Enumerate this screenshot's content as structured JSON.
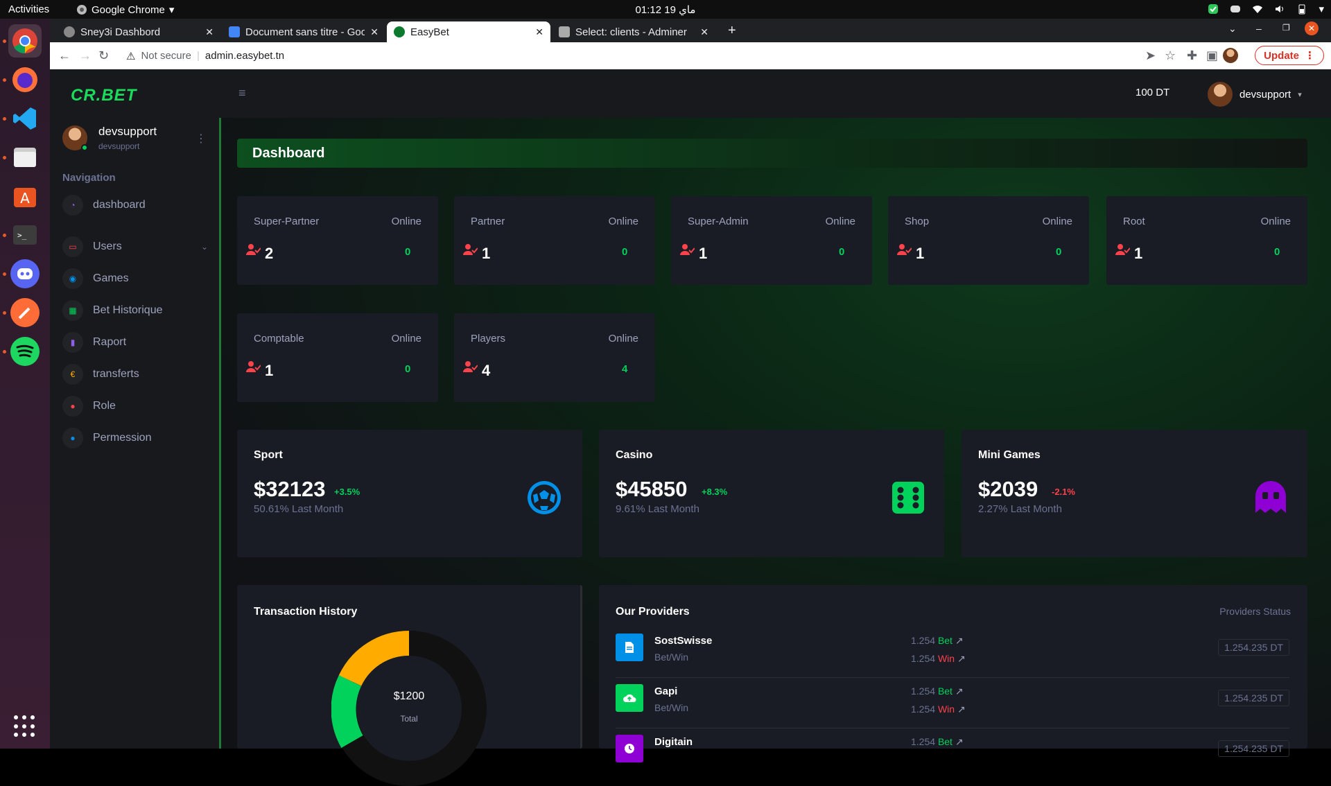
{
  "os_topbar": {
    "activities": "Activities",
    "app_name": "Google Chrome",
    "clock": "01:12  ماي 19"
  },
  "browser": {
    "tabs": [
      {
        "title": "Sney3i Dashbord",
        "active": false
      },
      {
        "title": "Document sans titre - Goo",
        "active": false
      },
      {
        "title": "EasyBet",
        "active": true
      },
      {
        "title": "Select: clients - Adminer",
        "active": false
      }
    ],
    "not_secure": "Not secure",
    "url": "admin.easybet.tn",
    "update_label": "Update"
  },
  "app": {
    "logo": "CR.BET",
    "balance": "100 DT",
    "username": "devsupport",
    "sidebar": {
      "user": {
        "name": "devsupport",
        "sub": "devsupport"
      },
      "nav_title": "Navigation",
      "items": [
        {
          "label": "dashboard",
          "icon": "speedometer-icon",
          "color": "#8f5fe8"
        },
        {
          "label": "Users",
          "icon": "monitor-icon",
          "color": "#fc424a"
        },
        {
          "label": "Games",
          "icon": "gamepad-icon",
          "color": "#0090e7"
        },
        {
          "label": "Bet Historique",
          "icon": "table-icon",
          "color": "#00d25b"
        },
        {
          "label": "Raport",
          "icon": "chart-icon",
          "color": "#8f5fe8"
        },
        {
          "label": "transferts",
          "icon": "euro-icon",
          "color": "#ffab00"
        },
        {
          "label": "Role",
          "icon": "pin-icon",
          "color": "#fc424a"
        },
        {
          "label": "Permession",
          "icon": "key-icon",
          "color": "#0090e7"
        }
      ]
    },
    "page_title": "Dashboard",
    "stats": [
      {
        "title": "Super-Partner",
        "online_label": "Online",
        "count": "2",
        "online": "0"
      },
      {
        "title": "Partner",
        "online_label": "Online",
        "count": "1",
        "online": "0"
      },
      {
        "title": "Super-Admin",
        "online_label": "Online",
        "count": "1",
        "online": "0"
      },
      {
        "title": "Shop",
        "online_label": "Online",
        "count": "1",
        "online": "0"
      },
      {
        "title": "Root",
        "online_label": "Online",
        "count": "1",
        "online": "0"
      },
      {
        "title": "Comptable",
        "online_label": "Online",
        "count": "1",
        "online": "0"
      },
      {
        "title": "Players",
        "online_label": "Online",
        "count": "4",
        "online": "4"
      }
    ],
    "categories": [
      {
        "title": "Sport",
        "value": "$32123",
        "change": "+3.5%",
        "change_color": "#00d25b",
        "sub": "50.61% Last Month",
        "icon": "soccer-ball-icon"
      },
      {
        "title": "Casino",
        "value": "$45850",
        "change": "+8.3%",
        "change_color": "#00d25b",
        "sub": "9.61% Last Month",
        "icon": "dice-icon"
      },
      {
        "title": "Mini Games",
        "value": "$2039",
        "change": "-2.1%",
        "change_color": "#fc424a",
        "sub": "2.27% Last Month",
        "icon": "ghost-icon"
      }
    ],
    "transaction_history": {
      "title": "Transaction History",
      "center_value": "$1200",
      "center_label": "Total"
    },
    "providers": {
      "title": "Our Providers",
      "status_label": "Providers Status",
      "rows": [
        {
          "name": "SostSwisse",
          "sub": "Bet/Win",
          "bet_value": "1.254",
          "bet_label": "Bet",
          "win_value": "1.254",
          "win_label": "Win",
          "amount": "1.254.235 DT",
          "icon_color": "#0090e7"
        },
        {
          "name": "Gapi",
          "sub": "Bet/Win",
          "bet_value": "1.254",
          "bet_label": "Bet",
          "win_value": "1.254",
          "win_label": "Win",
          "amount": "1.254.235 DT",
          "icon_color": "#00d25b"
        },
        {
          "name": "Digitain",
          "sub": "",
          "bet_value": "1.254",
          "bet_label": "Bet",
          "win_value": "",
          "win_label": "",
          "amount": "1.254.235 DT",
          "icon_color": "#8f5fe8"
        }
      ]
    }
  },
  "colors": {
    "accent_green": "#00d25b",
    "danger_red": "#fc424a",
    "card_bg": "#191c24",
    "donut_segments": [
      "#ffab00",
      "#00d25b",
      "#111111"
    ]
  }
}
